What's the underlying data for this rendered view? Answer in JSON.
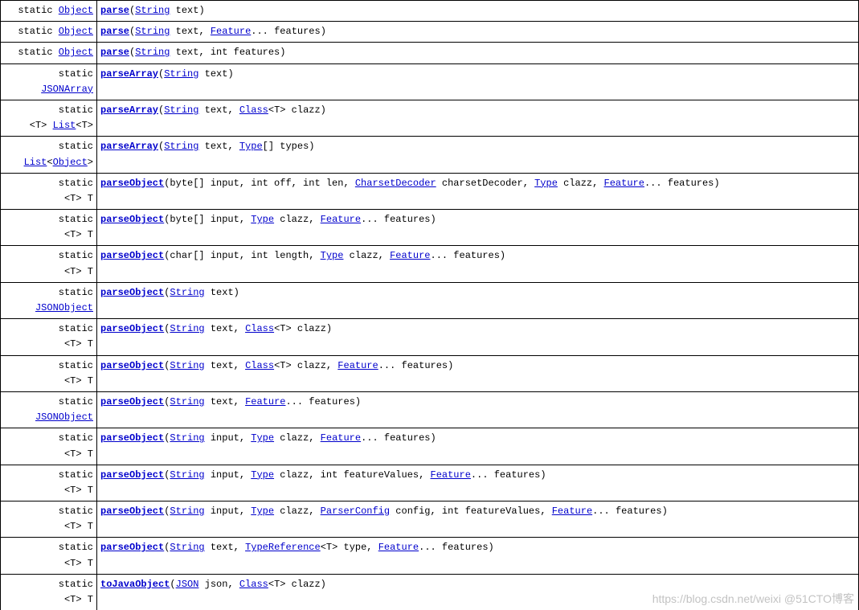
{
  "kw": {
    "static": "static",
    "int": "int",
    "charArr": "char[]",
    "byteArr": "byte[]",
    "brackets": "[]",
    "gen": "<T>",
    "genT": "<T> T",
    "listTclose": "<T>"
  },
  "types": {
    "Object": "Object",
    "String": "String",
    "Feature": "Feature",
    "JSONArray": "JSONArray",
    "List": "List",
    "Class": "Class",
    "Type": "Type",
    "CharsetDecoder": "CharsetDecoder",
    "JSONObject": "JSONObject",
    "TypeReference": "TypeReference",
    "ParserConfig": "ParserConfig",
    "JSON": "JSON"
  },
  "methods": {
    "parse": "parse",
    "parseArray": "parseArray",
    "parseObject": "parseObject",
    "toJavaObject": "toJavaObject"
  },
  "params": {
    "text": " text)",
    "text_featuresDots": " text, ",
    "features_tail": "... features)",
    "text_intFeatures": " text, int features)",
    "clazz_close": "<T> clazz)",
    "types_close": "[] types)",
    "input_off_len": "(byte[] input, int off, int len, ",
    "charsetDecoder": " charsetDecoder, ",
    "clazz_comma": " clazz, ",
    "input_byte": "(byte[] input, ",
    "input_char_len": "(char[] input, int length, ",
    "input_str": " input, ",
    "featureValues": " clazz, int featureValues, ",
    "config": " config, int featureValues, ",
    "type_comma": "<T> type, ",
    "json_comma": " json, "
  },
  "watermark": "https://blog.csdn.net/weixi   @51CTO博客"
}
